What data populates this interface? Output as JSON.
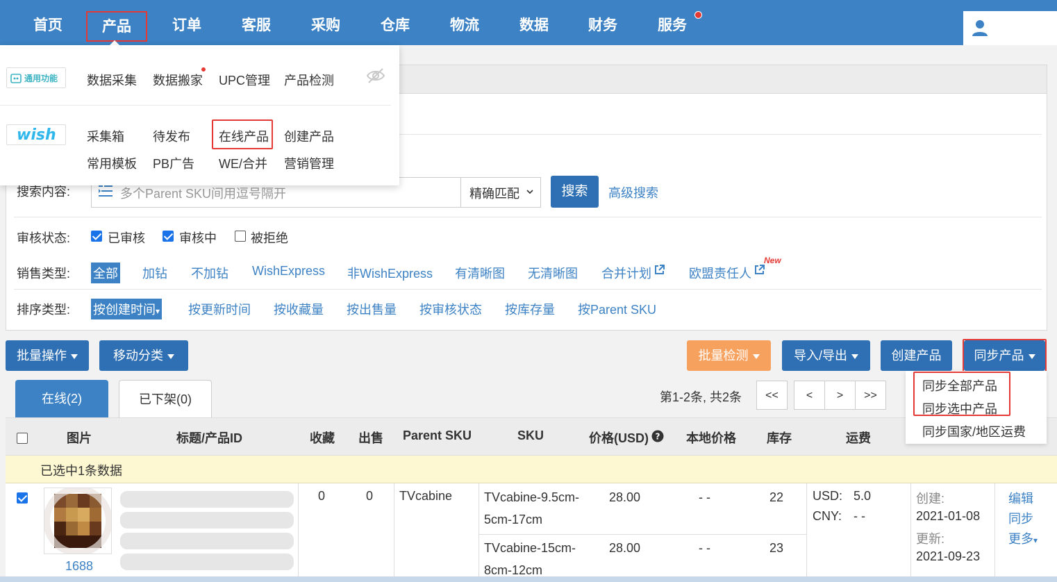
{
  "nav": {
    "items": [
      "首页",
      "产品",
      "订单",
      "客服",
      "采购",
      "仓库",
      "物流",
      "数据",
      "财务",
      "服务"
    ],
    "active": "产品"
  },
  "dropdown": {
    "general_logo": "通用功能",
    "general_items": [
      "数据采集",
      "数据搬家",
      "UPC管理",
      "产品检测"
    ],
    "wish_logo": "wish",
    "wish_row1": [
      "采集箱",
      "待发布",
      "在线产品",
      "创建产品"
    ],
    "wish_row2": [
      "常用模板",
      "PB广告",
      "WE/合并",
      "营销管理"
    ]
  },
  "search": {
    "label": "搜索内容:",
    "placeholder": "多个Parent SKU间用逗号隔开",
    "match_mode": "精确匹配",
    "search_button": "搜索",
    "advanced": "高级搜索"
  },
  "review": {
    "label": "审核状态:",
    "options": [
      {
        "label": "已审核",
        "checked": true
      },
      {
        "label": "审核中",
        "checked": true
      },
      {
        "label": "被拒绝",
        "checked": false
      }
    ]
  },
  "sales": {
    "label": "销售类型:",
    "options": [
      "全部",
      "加钻",
      "不加钻",
      "WishExpress",
      "非WishExpress",
      "有清晰图",
      "无清晰图",
      "合并计划",
      "欧盟责任人"
    ],
    "new_badge": "New"
  },
  "sort": {
    "label": "排序类型:",
    "options": [
      "按创建时间",
      "按更新时间",
      "按收藏量",
      "按出售量",
      "按审核状态",
      "按库存量",
      "按Parent SKU"
    ]
  },
  "actions": {
    "batch": "批量操作",
    "move": "移动分类",
    "batch_check": "批量检测",
    "import_export": "导入/导出",
    "create": "创建产品",
    "sync": "同步产品"
  },
  "sync_menu": [
    "同步全部产品",
    "同步选中产品",
    "同步国家/地区运费"
  ],
  "tabs": {
    "online": "在线(2)",
    "offline": "已下架(0)"
  },
  "pager": {
    "info": "第1-2条, 共2条",
    "first": "<<",
    "prev": "<",
    "next": ">",
    "last": ">>"
  },
  "table": {
    "headers": [
      "图片",
      "标题/产品ID",
      "收藏",
      "出售",
      "Parent SKU",
      "SKU",
      "价格(USD)",
      "本地价格",
      "库存",
      "运费"
    ],
    "selected_banner": "已选中1条数据",
    "row": {
      "source": "1688",
      "favorites": "0",
      "sold": "0",
      "parent_sku": "TVcabine",
      "variants": [
        {
          "sku_line1": "TVcabine-9.5cm-",
          "sku_line2": "5cm-17cm",
          "price": "28.00",
          "local_price": "- -",
          "stock": "22"
        },
        {
          "sku_line1": "TVcabine-15cm-",
          "sku_line2": "8cm-12cm",
          "price": "28.00",
          "local_price": "- -",
          "stock": "23"
        }
      ],
      "shipping_usd_label": "USD:",
      "shipping_usd": "5.0",
      "shipping_cny_label": "CNY:",
      "shipping_cny": "- -",
      "created_label": "创建:",
      "created": "2021-01-08",
      "updated_label": "更新:",
      "updated": "2021-09-23",
      "edit": "编辑",
      "sync": "同步",
      "more": "更多"
    }
  },
  "colors": {
    "primary": "#3d82c4",
    "button": "#2f70b4",
    "orange": "#f7a15e",
    "highlight": "#e53935",
    "banner": "#fdf8d2"
  }
}
